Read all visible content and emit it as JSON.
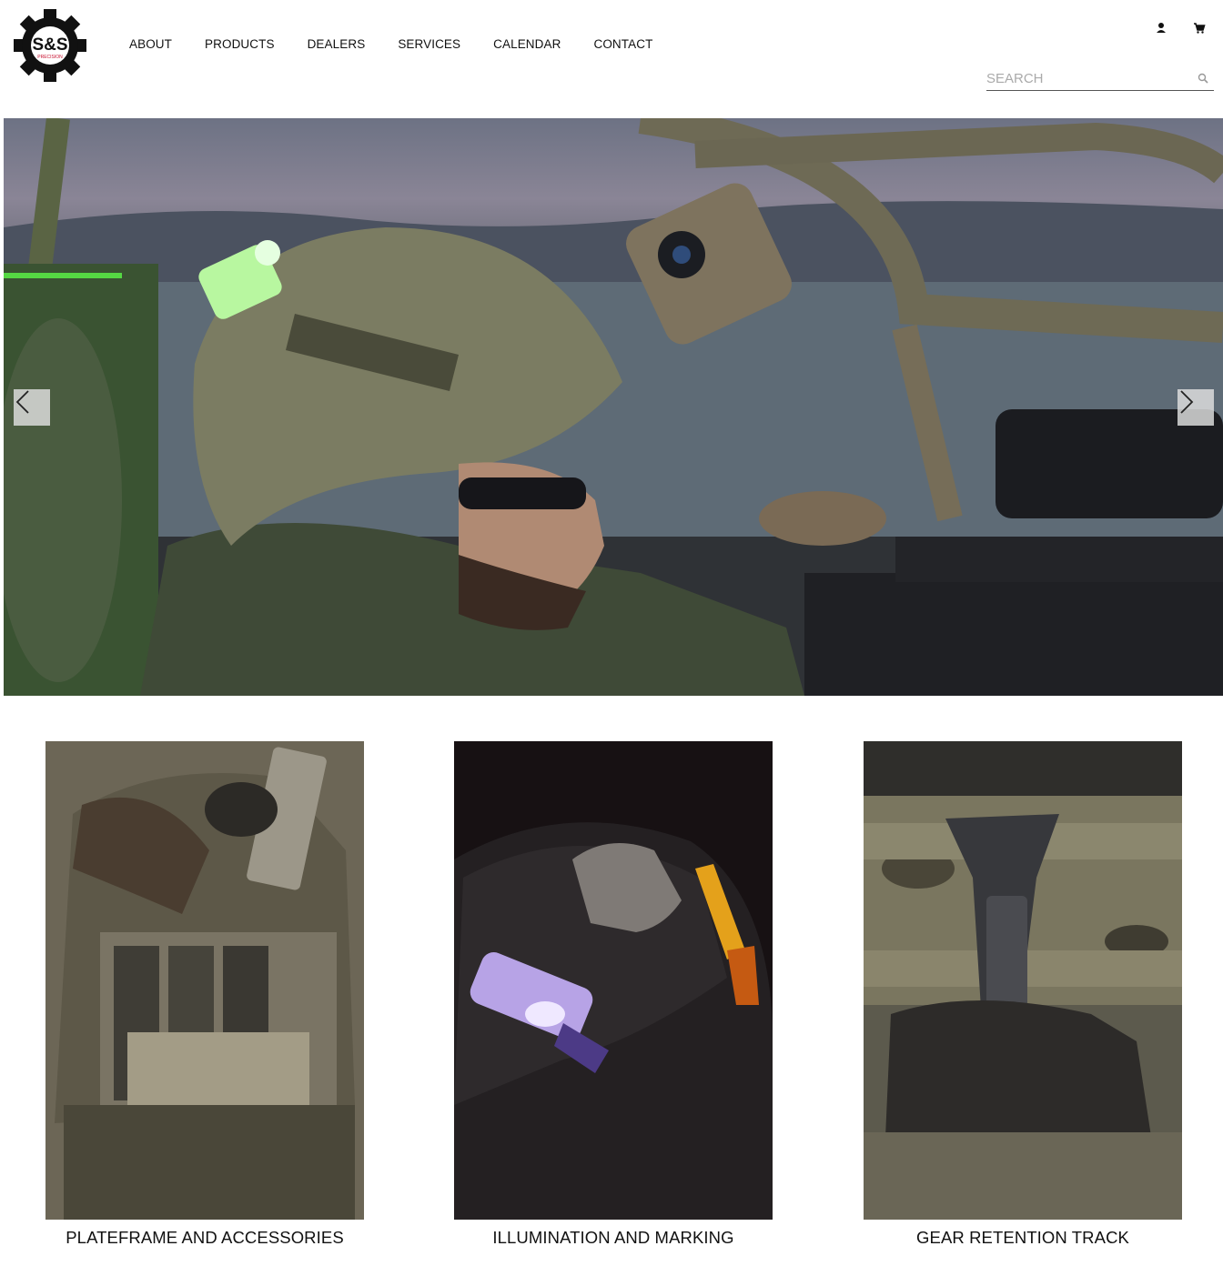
{
  "header": {
    "logo": {
      "text": "S&S",
      "subtext": "PRECISION",
      "icon": "gear-logo-icon"
    },
    "nav": [
      "ABOUT",
      "PRODUCTS",
      "DEALERS",
      "SERVICES",
      "CALENDAR",
      "CONTACT"
    ],
    "utility": {
      "account_icon": "user-icon",
      "cart_icon": "cart-icon"
    },
    "search": {
      "placeholder": "SEARCH",
      "icon": "search-icon"
    }
  },
  "hero": {
    "prev_icon": "chevron-left-icon",
    "next_icon": "chevron-right-icon"
  },
  "tiles": [
    {
      "caption": "PLATEFRAME AND ACCESSORIES"
    },
    {
      "caption": "ILLUMINATION AND MARKING"
    },
    {
      "caption": "GEAR RETENTION TRACK"
    }
  ],
  "colors": {
    "accent": "#c8102e",
    "text": "#111111",
    "background": "#ffffff"
  }
}
